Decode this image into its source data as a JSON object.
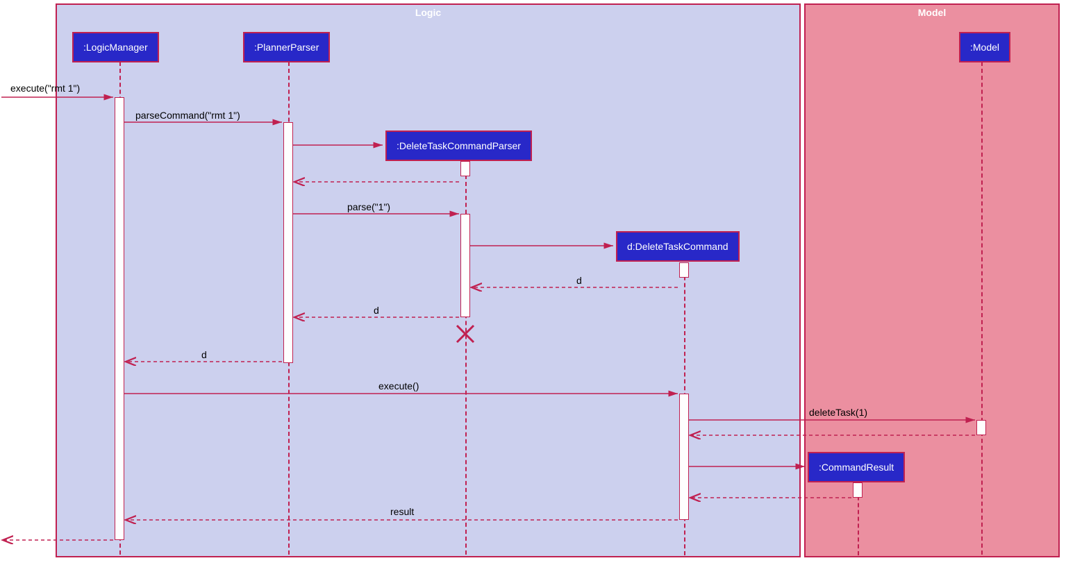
{
  "frames": {
    "logic": {
      "title": "Logic"
    },
    "model": {
      "title": "Model"
    }
  },
  "participants": {
    "logicManager": ":LogicManager",
    "plannerParser": ":PlannerParser",
    "deleteTaskCommandParser": ":DeleteTaskCommandParser",
    "deleteTaskCommand": "d:DeleteTaskCommand",
    "commandResult": ":CommandResult",
    "model": ":Model"
  },
  "messages": {
    "execute_rmt1": "execute(\"rmt 1\")",
    "parseCommand": "parseCommand(\"rmt 1\")",
    "parse1": "parse(\"1\")",
    "d1": "d",
    "d2": "d",
    "d3": "d",
    "execute": "execute()",
    "deleteTask": "deleteTask(1)",
    "result": "result"
  }
}
